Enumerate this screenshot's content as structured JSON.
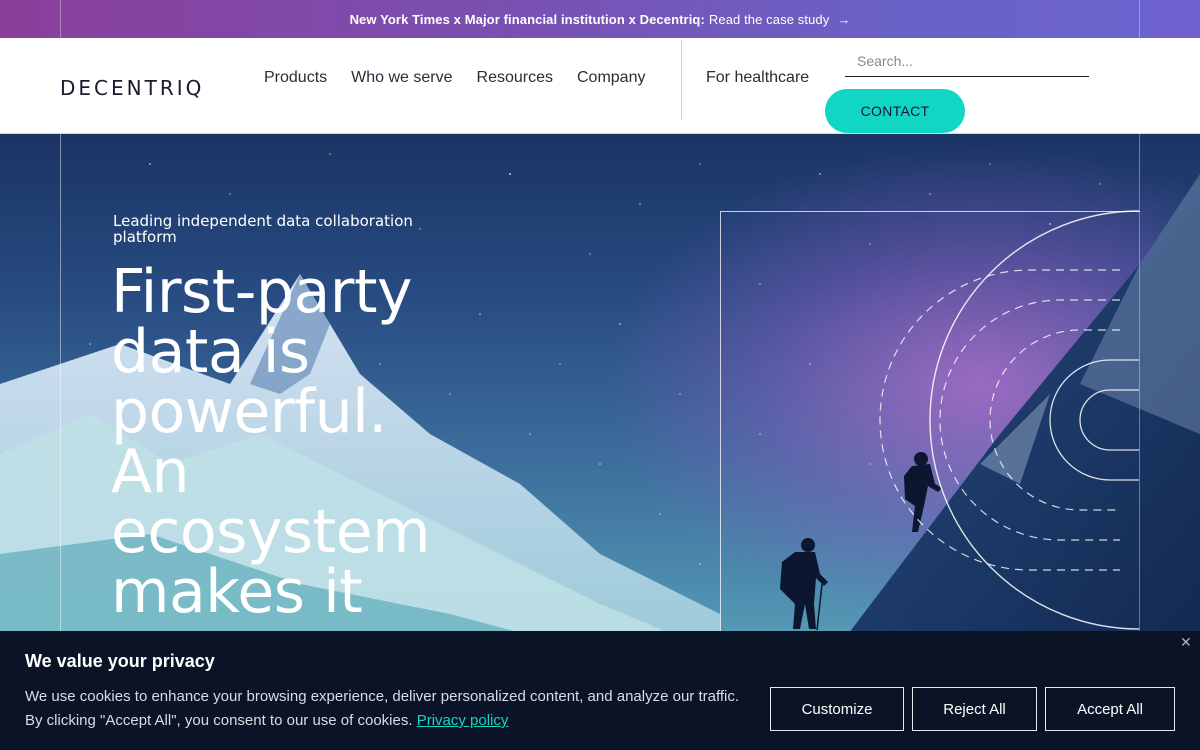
{
  "announcement": {
    "bold": "New York Times x Major financial institution x Decentriq:",
    "link": "Read the case study",
    "arrow": "→"
  },
  "header": {
    "logo": "DECENTRIQ",
    "nav": [
      "Products",
      "Who we serve",
      "Resources",
      "Company"
    ],
    "healthcare": "For healthcare",
    "search_placeholder": "Search...",
    "contact": "CONTACT"
  },
  "hero": {
    "eyebrow": "Leading independent data collaboration platform",
    "headline": "First-party data is powerful. An ecosystem makes it"
  },
  "cookie": {
    "title": "We value your privacy",
    "text": "We use cookies to enhance your browsing experience, deliver personalized content, and analyze our traffic. By clicking \"Accept All\", you consent to our use of cookies.",
    "policy": "Privacy policy",
    "close": "✕",
    "customize": "Customize",
    "reject": "Reject All",
    "accept": "Accept All"
  },
  "colors": {
    "accent": "#12d6c4",
    "banner_bg": "#0b1426"
  }
}
